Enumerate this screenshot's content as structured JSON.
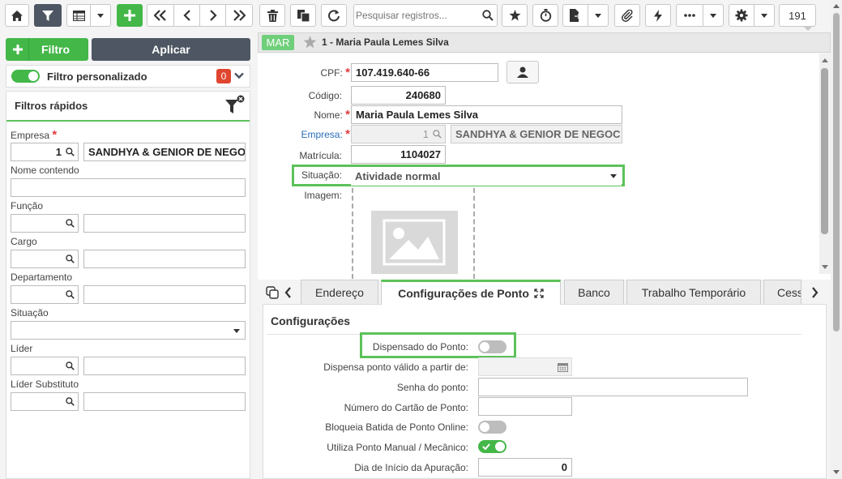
{
  "toolbar": {
    "search_placeholder": "Pesquisar registros...",
    "record_count": "191"
  },
  "left_panel": {
    "filter_button": "Filtro",
    "apply_button": "Aplicar",
    "custom_filter_label": "Filtro personalizado",
    "custom_filter_count": "0",
    "quick_filters_title": "Filtros rápidos",
    "fields": {
      "empresa_label": "Empresa",
      "empresa_code": "1",
      "empresa_name": "SANDHYA & GENIOR DE NEGOC",
      "nome_contendo_label": "Nome contendo",
      "funcao_label": "Função",
      "cargo_label": "Cargo",
      "departamento_label": "Departamento",
      "situacao_label": "Situação",
      "lider_label": "Líder",
      "lider_substituto_label": "Líder Substituto"
    }
  },
  "record": {
    "badge": "MAR",
    "title": "1 - Maria Paula Lemes Silva",
    "cpf_label": "CPF:",
    "cpf_value": "107.419.640-66",
    "codigo_label": "Código:",
    "codigo_value": "240680",
    "nome_label": "Nome:",
    "nome_value": "Maria Paula Lemes Silva",
    "empresa_label": "Empresa:",
    "empresa_code": "1",
    "empresa_name": "SANDHYA & GENIOR DE NEGOC",
    "matricula_label": "Matrícula:",
    "matricula_value": "1104027",
    "situacao_label": "Situação:",
    "situacao_value": "Atividade normal",
    "imagem_label": "Imagem:"
  },
  "tabs": [
    "Endereço",
    "Configurações de Ponto",
    "Banco",
    "Trabalho Temporário",
    "Cess"
  ],
  "config": {
    "section_title": "Configurações",
    "dispensado_label": "Dispensado do Ponto:",
    "dispensado_on": false,
    "dispensa_valido_label": "Dispensa ponto válido a partir de:",
    "senha_label": "Senha do ponto:",
    "cartao_label": "Número do Cartão de Ponto:",
    "bloqueia_label": "Bloqueia Batida de Ponto Online:",
    "bloqueia_on": false,
    "utiliza_label": "Utiliza Ponto Manual / Mecânico:",
    "utiliza_on": true,
    "dia_inicio_label": "Dia de Início da Apuração:",
    "dia_inicio_value": "0"
  },
  "colors": {
    "green": "#44b749",
    "dark": "#4d5662",
    "highlight": "#5cc25a",
    "badge": "#6fcf7a",
    "link": "#2a6ebb",
    "required": "#e23d3d"
  }
}
